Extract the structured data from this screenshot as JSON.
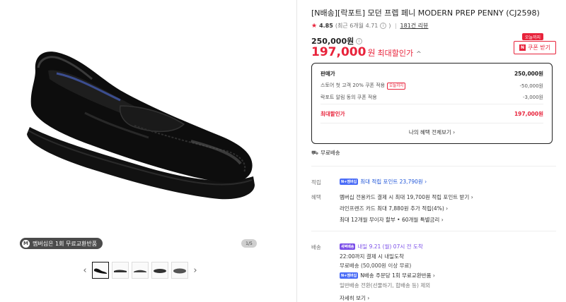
{
  "gallery": {
    "benefit_pill": "멤버십은 1회 무료교환반품",
    "benefit_icon": "M",
    "page_indicator": "1/5",
    "thumb_count": 5
  },
  "product": {
    "title": "[N배송][락포트] 모던 프렙 페니 MODERN PREP PENNY (CJ2598)",
    "rating": "4.85",
    "rating_sub": "(최근 6개월 4.71",
    "rating_sub_close": ")",
    "review_link": "181건 리뷰",
    "original_price": "250,000원",
    "sale_price_num": "197,000",
    "sale_price_unit": "원",
    "sale_price_label": "최대할인가",
    "caret": "^"
  },
  "coupon": {
    "tag": "오늘까지",
    "button_mark": "N",
    "button_label": "쿠폰 받기"
  },
  "price_box": {
    "rows": [
      {
        "label": "판매가",
        "value": "250,000원"
      },
      {
        "label": "스토어 첫 고객 20% 쿠폰 적용",
        "tag": "오늘까지",
        "value": "-50,000원"
      },
      {
        "label": "락포트 알림 동의 쿠폰 적용",
        "value": "-3,000원"
      },
      {
        "label": "최대할인가",
        "value": "197,000원"
      }
    ],
    "view_all": "나의 혜택 전체보기 ›"
  },
  "shipping_free": "무료배송",
  "points": {
    "label": "적립",
    "badge": "N+멤버십",
    "text": "최대 적립 포인트 23,790원 ›"
  },
  "benefits": {
    "label": "혜택",
    "lines": [
      "멤버십 전용카드 결제 시 최대 19,700원 적립 포인트 받기 ›",
      "라인프렌즈 카드 최대 7,880원 추가 적립(4%) ›",
      "최대 12개월 무이자 할부 • 60개월 특별금리 ›"
    ]
  },
  "delivery": {
    "label": "배송",
    "badge": "새벽배송",
    "arrival": "내일 9.21 (월) 07시 전 도착",
    "lines": [
      "22:00까지 결제 시 내일도착",
      "무료배송 (50,000원 이상 무료)"
    ],
    "return_badge": "N+멤버십",
    "return_text": "N배송 주문당 1회 무료교환반품 ›",
    "exclusion": "일반배송 전환(선물하기, 합배송 등) 제외",
    "detail_link": "자세히 보기 ›"
  },
  "colors": {
    "accent": "#e8233b",
    "points_blue": "#1f55d8",
    "dawn_purple": "#7b4ee8"
  }
}
